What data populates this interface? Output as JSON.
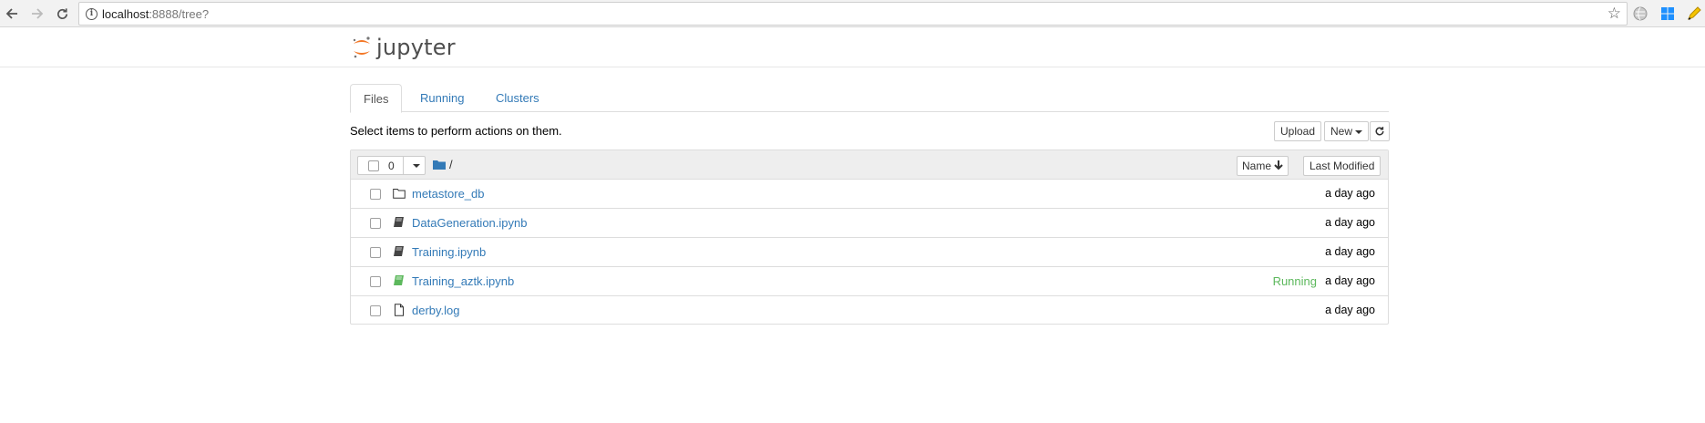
{
  "browser": {
    "url_host": "localhost",
    "url_rest": ":8888/tree?",
    "back_icon": "arrow-left-icon",
    "forward_icon": "arrow-right-icon",
    "reload_icon": "reload-icon",
    "star_icon": "star-icon"
  },
  "app": {
    "logo_text": "jupyter",
    "accent": "#f37726"
  },
  "tabs": [
    {
      "label": "Files",
      "active": true
    },
    {
      "label": "Running",
      "active": false
    },
    {
      "label": "Clusters",
      "active": false
    }
  ],
  "toolbar": {
    "hint": "Select items to perform actions on them.",
    "upload_label": "Upload",
    "new_label": "New",
    "refresh_icon": "refresh-icon"
  },
  "list_header": {
    "selected_count": "0",
    "path": "/",
    "sort_name_label": "Name",
    "sort_modified_label": "Last Modified"
  },
  "files": [
    {
      "name": "metastore_db",
      "type": "folder",
      "status": "",
      "modified": "a day ago"
    },
    {
      "name": "DataGeneration.ipynb",
      "type": "notebook",
      "status": "",
      "modified": "a day ago"
    },
    {
      "name": "Training.ipynb",
      "type": "notebook",
      "status": "",
      "modified": "a day ago"
    },
    {
      "name": "Training_aztk.ipynb",
      "type": "notebook-running",
      "status": "Running",
      "modified": "a day ago"
    },
    {
      "name": "derby.log",
      "type": "file",
      "status": "",
      "modified": "a day ago"
    }
  ]
}
